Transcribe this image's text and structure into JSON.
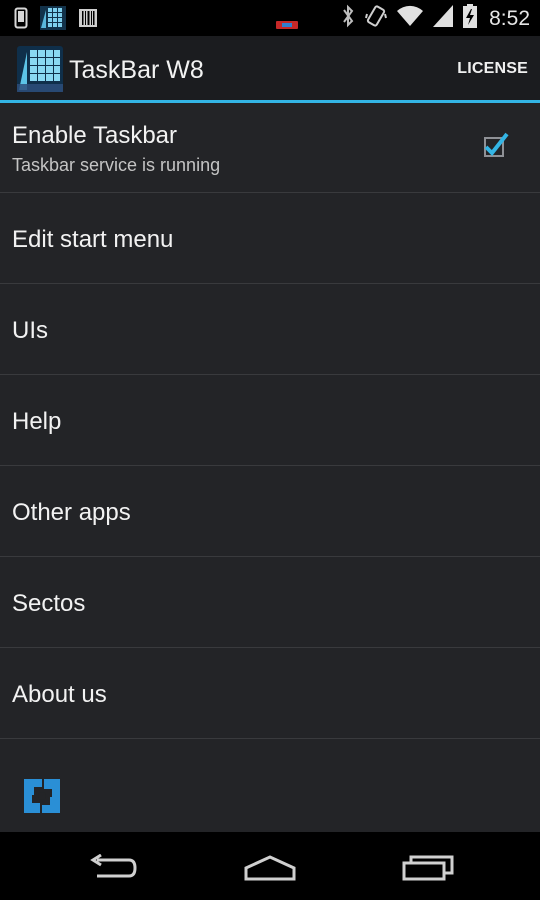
{
  "status_bar": {
    "time": "8:52",
    "icons": [
      "phone-icon",
      "taskbar-app-icon",
      "barcode-icon",
      "battery-saver-icon",
      "bluetooth-icon",
      "vibrate-icon",
      "wifi-icon",
      "signal-icon",
      "battery-charging-icon"
    ]
  },
  "action_bar": {
    "title": "TaskBar W8",
    "license_label": "LICENSE",
    "accent_color": "#33b5e5"
  },
  "list": {
    "items": [
      {
        "title": "Enable Taskbar",
        "subtitle": "Taskbar service is running",
        "checked": true
      },
      {
        "title": "Edit start menu"
      },
      {
        "title": "UIs"
      },
      {
        "title": "Help"
      },
      {
        "title": "Other apps"
      },
      {
        "title": "Sectos"
      },
      {
        "title": "About us"
      }
    ]
  },
  "footer": {
    "logo_icon": "sectos-logo-icon",
    "logo_color": "#2a8fd6"
  },
  "nav_bar": {
    "icons": [
      "back-icon",
      "home-icon",
      "recent-apps-icon"
    ]
  }
}
